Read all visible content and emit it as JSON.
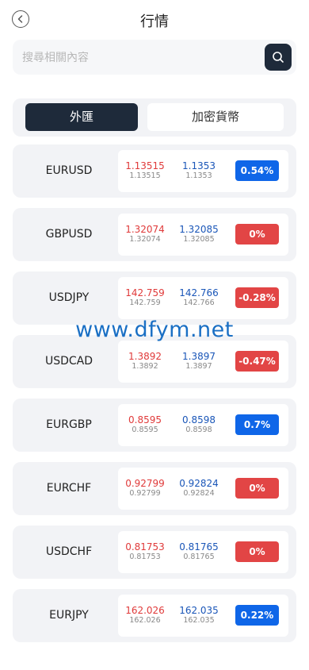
{
  "header": {
    "title": "行情"
  },
  "search": {
    "placeholder": "搜尋相關內容"
  },
  "tabs": [
    {
      "label": "外匯",
      "active": true
    },
    {
      "label": "加密貨幣",
      "active": false
    }
  ],
  "colors": {
    "up": "#0f66e8",
    "down": "#e24545",
    "dark": "#1e2a3a"
  },
  "watermark": "www.dfym.net",
  "quotes": [
    {
      "symbol": "EURUSD",
      "bid": "1.13515",
      "bid_sub": "1.13515",
      "ask": "1.1353",
      "ask_sub": "1.1353",
      "change": "0.54%",
      "dir": "up"
    },
    {
      "symbol": "GBPUSD",
      "bid": "1.32074",
      "bid_sub": "1.32074",
      "ask": "1.32085",
      "ask_sub": "1.32085",
      "change": "0%",
      "dir": "down"
    },
    {
      "symbol": "USDJPY",
      "bid": "142.759",
      "bid_sub": "142.759",
      "ask": "142.766",
      "ask_sub": "142.766",
      "change": "-0.28%",
      "dir": "down"
    },
    {
      "symbol": "USDCAD",
      "bid": "1.3892",
      "bid_sub": "1.3892",
      "ask": "1.3897",
      "ask_sub": "1.3897",
      "change": "-0.47%",
      "dir": "down"
    },
    {
      "symbol": "EURGBP",
      "bid": "0.8595",
      "bid_sub": "0.8595",
      "ask": "0.8598",
      "ask_sub": "0.8598",
      "change": "0.7%",
      "dir": "up"
    },
    {
      "symbol": "EURCHF",
      "bid": "0.92799",
      "bid_sub": "0.92799",
      "ask": "0.92824",
      "ask_sub": "0.92824",
      "change": "0%",
      "dir": "down"
    },
    {
      "symbol": "USDCHF",
      "bid": "0.81753",
      "bid_sub": "0.81753",
      "ask": "0.81765",
      "ask_sub": "0.81765",
      "change": "0%",
      "dir": "down"
    },
    {
      "symbol": "EURJPY",
      "bid": "162.026",
      "bid_sub": "162.026",
      "ask": "162.035",
      "ask_sub": "162.035",
      "change": "0.22%",
      "dir": "up"
    }
  ]
}
